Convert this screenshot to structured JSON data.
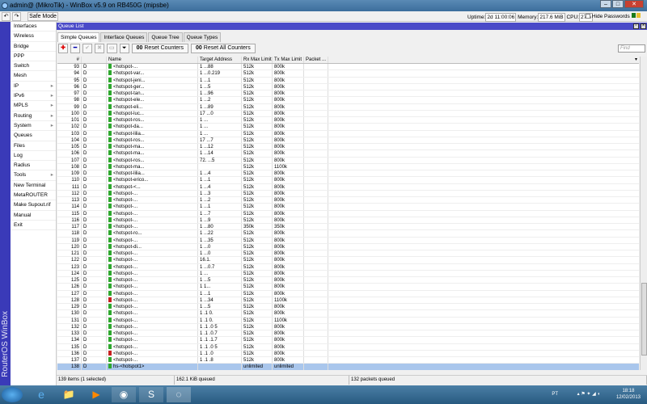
{
  "title": "admin@        (MikroTik) - WinBox v5.9 on RB450G (mipsbe)",
  "topbar": {
    "undo": "↶",
    "redo": "↷",
    "safe_mode": "Safe Mode",
    "uptime_label": "Uptime:",
    "uptime": "2d 11:00:06",
    "memory_label": "Memory:",
    "memory": "217.6 MiB",
    "cpu_label": "CPU:",
    "cpu": "27%",
    "hide_passwords": "Hide Passwords"
  },
  "brand": "RouterOS WinBox",
  "sidebar": [
    {
      "label": "Interfaces"
    },
    {
      "label": "Wireless"
    },
    {
      "label": "Bridge"
    },
    {
      "label": "PPP"
    },
    {
      "label": "Switch"
    },
    {
      "label": "Mesh"
    },
    {
      "label": "IP",
      "sub": true
    },
    {
      "label": "IPv6",
      "sub": true
    },
    {
      "label": "MPLS",
      "sub": true
    },
    {
      "label": "Routing",
      "sub": true
    },
    {
      "label": "System",
      "sub": true
    },
    {
      "label": "Queues"
    },
    {
      "label": "Files"
    },
    {
      "label": "Log"
    },
    {
      "label": "Radius"
    },
    {
      "label": "Tools",
      "sub": true
    },
    {
      "label": "New Terminal"
    },
    {
      "label": "MetaROUTER"
    },
    {
      "label": "Make Supout.rif"
    },
    {
      "label": "Manual"
    },
    {
      "label": "Exit"
    }
  ],
  "window": {
    "title": "Queue List",
    "tabs": [
      "Simple Queues",
      "Interface Queues",
      "Queue Tree",
      "Queue Types"
    ],
    "reset_counters": "Reset Counters",
    "reset_all_counters": "Reset All Counters",
    "find_placeholder": "Find"
  },
  "columns": [
    "#",
    "",
    "Name",
    "Target Address",
    "Rx Max Limit",
    "Tx Max Limit",
    "Packet ..."
  ],
  "rows": [
    [
      "93",
      "D",
      "<hotspot-...",
      "1 ...88",
      "512k",
      "800k",
      "g"
    ],
    [
      "94",
      "D",
      "<hotspot-var...",
      "1 ...0.219",
      "512k",
      "800k",
      "g"
    ],
    [
      "95",
      "D",
      "<hotspot-jeni...",
      "1 ...1",
      "512k",
      "800k",
      "g"
    ],
    [
      "96",
      "D",
      "<hotspot-ger...",
      "1 ...5",
      "512k",
      "800k",
      "g"
    ],
    [
      "97",
      "D",
      "<hotspot-tan...",
      "1 ...96",
      "512k",
      "800k",
      "g"
    ],
    [
      "98",
      "D",
      "<hotspot-ele...",
      "1 ...2",
      "512k",
      "800k",
      "g"
    ],
    [
      "99",
      "D",
      "<hotspot-eli...",
      "1 ...89",
      "512k",
      "800k",
      "g"
    ],
    [
      "100",
      "D",
      "<hotspot-luc...",
      "17 ...0",
      "512k",
      "800k",
      "g"
    ],
    [
      "101",
      "D",
      "<hotspot-ros...",
      "1 ...",
      "512k",
      "800k",
      "g"
    ],
    [
      "102",
      "D",
      "<hotspot-da...",
      "1 ...",
      "512k",
      "800k",
      "g"
    ],
    [
      "103",
      "D",
      "<hotspot-lilia...",
      "1 ...",
      "512k",
      "800k",
      "g"
    ],
    [
      "104",
      "D",
      "<hotspot-ros...",
      "17 ...7",
      "512k",
      "800k",
      "g"
    ],
    [
      "105",
      "D",
      "<hotspot-ma...",
      "1 ...12",
      "512k",
      "800k",
      "g"
    ],
    [
      "106",
      "D",
      "<hotspot-ma...",
      "1 ...14",
      "512k",
      "800k",
      "g"
    ],
    [
      "107",
      "D",
      "<hotspot-ros...",
      "72. ...5",
      "512k",
      "800k",
      "g"
    ],
    [
      "108",
      "D",
      "<hotspot-ma...",
      "",
      "512k",
      "1100k",
      "g"
    ],
    [
      "109",
      "D",
      "<hotspot-lilia...",
      "1 ...4",
      "512k",
      "800k",
      "g"
    ],
    [
      "110",
      "D",
      "<hotspot-erico...",
      "1 ...1",
      "512k",
      "800k",
      "g"
    ],
    [
      "111",
      "D",
      "<hotspot-<...",
      "1 ...4",
      "512k",
      "800k",
      "g"
    ],
    [
      "112",
      "D",
      "<hotspot-...",
      "1 ...3",
      "512k",
      "800k",
      "g"
    ],
    [
      "113",
      "D",
      "<hotspot-...",
      "1 ...2",
      "512k",
      "800k",
      "g"
    ],
    [
      "114",
      "D",
      "<hotspot-...",
      "1 ...1",
      "512k",
      "800k",
      "g"
    ],
    [
      "115",
      "D",
      "<hotspot-...",
      "1 ...7",
      "512k",
      "800k",
      "g"
    ],
    [
      "116",
      "D",
      "<hotspot-...",
      "1 ...9",
      "512k",
      "800k",
      "g"
    ],
    [
      "117",
      "D",
      "<hotspot-...",
      "1 ...80",
      "350k",
      "350k",
      "g"
    ],
    [
      "118",
      "D",
      "<hotspot-ro...",
      "1 ...22",
      "512k",
      "800k",
      "g"
    ],
    [
      "119",
      "D",
      "<hotspot-...",
      "1 ...35",
      "512k",
      "800k",
      "g"
    ],
    [
      "120",
      "D",
      "<hotspot-di...",
      "1 ...0",
      "512k",
      "800k",
      "g"
    ],
    [
      "121",
      "D",
      "<hotspot-...",
      "1 ...0",
      "512k",
      "800k",
      "g"
    ],
    [
      "122",
      "D",
      "<hotspot-...",
      "16.1.",
      "512k",
      "800k",
      "g"
    ],
    [
      "123",
      "D",
      "<hotspot-...",
      "1 ...0.7",
      "512k",
      "800k",
      "g"
    ],
    [
      "124",
      "D",
      "<hotspot-...",
      "1 ...",
      "512k",
      "800k",
      "g"
    ],
    [
      "125",
      "D",
      "<hotspot-...",
      "1 ...5",
      "512k",
      "800k",
      "g"
    ],
    [
      "126",
      "D",
      "<hotspot-...",
      "1 1...",
      "512k",
      "800k",
      "g"
    ],
    [
      "127",
      "D",
      "<hotspot-...",
      "1 ...1",
      "512k",
      "800k",
      "g"
    ],
    [
      "128",
      "D",
      "<hotspot-...",
      "1 ...34",
      "512k",
      "1100k",
      "r"
    ],
    [
      "129",
      "D",
      "<hotspot-...",
      "1 ...5",
      "512k",
      "800k",
      "g"
    ],
    [
      "130",
      "D",
      "<hotspot-...",
      "1 .1 0.",
      "512k",
      "800k",
      "g"
    ],
    [
      "131",
      "D",
      "<hotspot-...",
      "1 .1 0.",
      "512k",
      "1100k",
      "g"
    ],
    [
      "132",
      "D",
      "<hotspot-...",
      "1 .1 .0 5",
      "512k",
      "800k",
      "g"
    ],
    [
      "133",
      "D",
      "<hotspot-...",
      "1 .1 .0.7",
      "512k",
      "800k",
      "g"
    ],
    [
      "134",
      "D",
      "<hotspot-...",
      "1 .1 .1.7",
      "512k",
      "800k",
      "g"
    ],
    [
      "135",
      "D",
      "<hotspot-...",
      "1 .1 .0 5",
      "512k",
      "800k",
      "g"
    ],
    [
      "136",
      "D",
      "<hotspot-...",
      "1 .1 .0",
      "512k",
      "800k",
      "r"
    ],
    [
      "137",
      "D",
      "<hotspot-...",
      "1 .1 .8",
      "512k",
      "800k",
      "g"
    ],
    [
      "138",
      "D",
      "hs-<hotspot1>",
      "",
      "unlimited",
      "unlimited",
      "g"
    ]
  ],
  "selected_row": "138",
  "status": {
    "items": "139 items (1 selected)",
    "queued_bytes": "162.1 KiB queued",
    "queued_packets": "132 packets queued"
  },
  "taskbar": {
    "lang": "PT",
    "time": "18:18",
    "date": "12/02/2013"
  },
  "colors": {
    "title_blue": "#4a4ac8",
    "icon_green": "#2ea82e",
    "icon_red": "#c82020",
    "selected": "#a9c6ec"
  }
}
